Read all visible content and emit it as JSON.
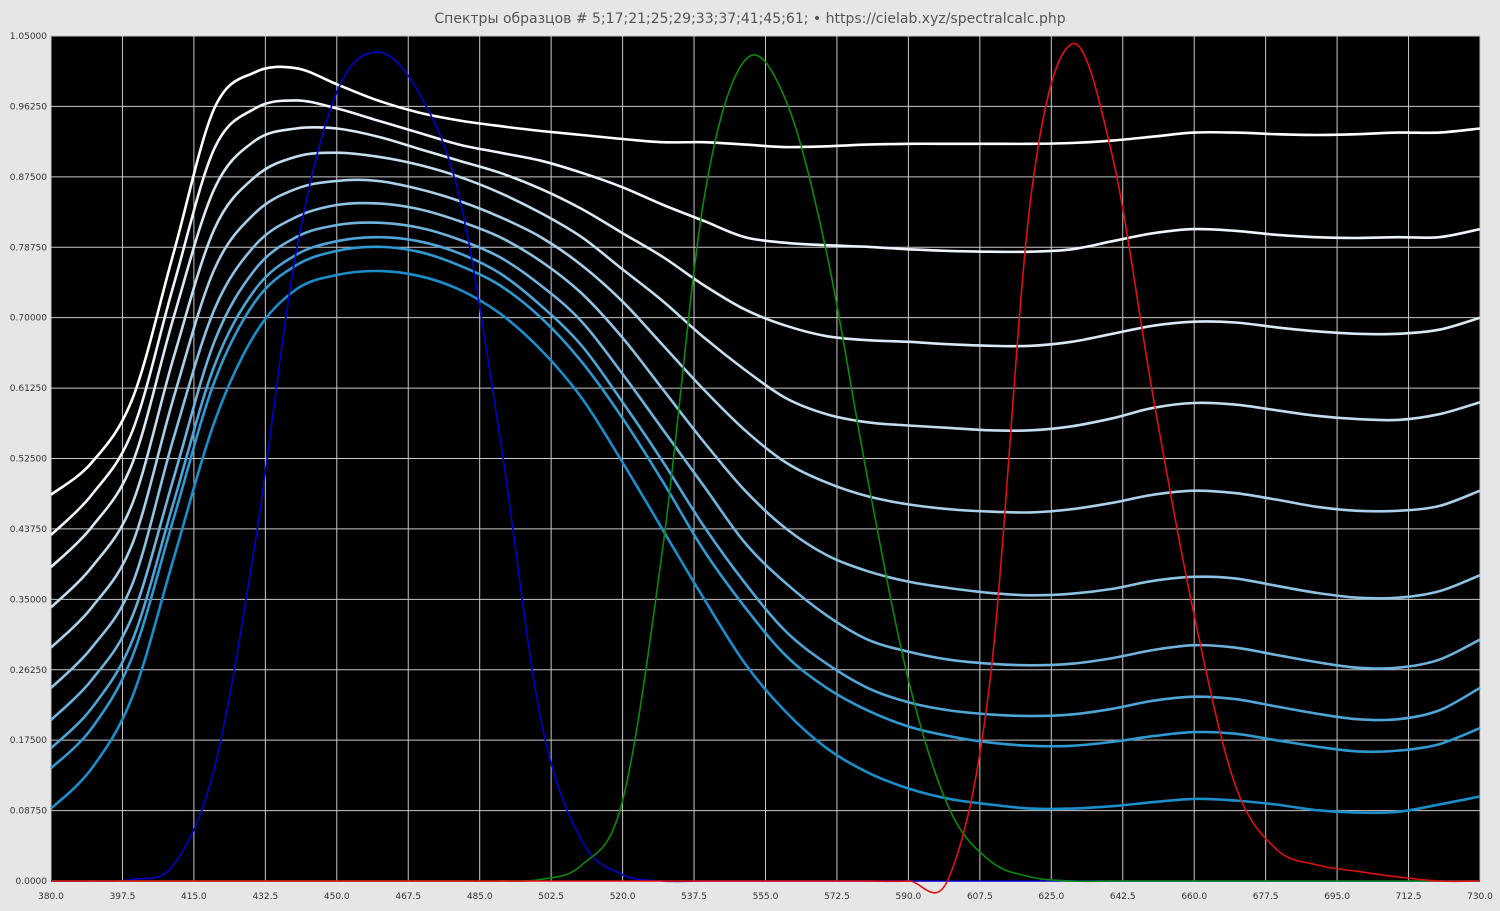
{
  "title": "Спектры образцов # 5;17;21;25;29;33;37;41;45;61;  •  https://cielab.xyz/spectralcalc.php",
  "chart_data": {
    "type": "line",
    "title": "Спектры образцов # 5;17;21;25;29;33;37;41;45;61;  •  https://cielab.xyz/spectralcalc.php",
    "xlim": [
      380,
      730
    ],
    "ylim": [
      0,
      1.05
    ],
    "xticks": [
      "380.0",
      "397.5",
      "415.0",
      "432.5",
      "450.0",
      "467.5",
      "485.0",
      "502.5",
      "520.0",
      "537.5",
      "555.0",
      "572.5",
      "590.0",
      "607.5",
      "625.0",
      "642.5",
      "660.0",
      "677.5",
      "695.0",
      "712.5",
      "730.0"
    ],
    "yticks": [
      "0.0000",
      "0.08750",
      "0.17500",
      "0.26250",
      "0.35000",
      "0.43750",
      "0.52500",
      "0.61250",
      "0.70000",
      "0.78750",
      "0.87500",
      "0.96250",
      "1.05000"
    ],
    "grid": true,
    "background": "#000000",
    "x": [
      380,
      390,
      400,
      410,
      420,
      430,
      440,
      450,
      460,
      470,
      480,
      490,
      500,
      510,
      520,
      530,
      540,
      550,
      560,
      570,
      580,
      590,
      600,
      610,
      620,
      630,
      640,
      650,
      660,
      670,
      680,
      690,
      700,
      710,
      720,
      730
    ],
    "series": [
      {
        "color": "#ffffff",
        "values": [
          0.48,
          0.52,
          0.6,
          0.78,
          0.96,
          1.005,
          1.01,
          0.99,
          0.97,
          0.955,
          0.945,
          0.938,
          0.932,
          0.927,
          0.922,
          0.918,
          0.918,
          0.915,
          0.912,
          0.913,
          0.915,
          0.916,
          0.916,
          0.916,
          0.916,
          0.917,
          0.92,
          0.925,
          0.93,
          0.93,
          0.928,
          0.927,
          0.928,
          0.93,
          0.93,
          0.935
        ]
      },
      {
        "color": "#eef5fa",
        "values": [
          0.43,
          0.48,
          0.56,
          0.74,
          0.91,
          0.96,
          0.97,
          0.96,
          0.945,
          0.93,
          0.915,
          0.905,
          0.895,
          0.88,
          0.862,
          0.84,
          0.82,
          0.8,
          0.793,
          0.79,
          0.788,
          0.785,
          0.783,
          0.782,
          0.782,
          0.785,
          0.795,
          0.805,
          0.81,
          0.808,
          0.803,
          0.8,
          0.799,
          0.8,
          0.8,
          0.81
        ]
      },
      {
        "color": "#d9eaf5",
        "values": [
          0.39,
          0.44,
          0.52,
          0.7,
          0.86,
          0.92,
          0.935,
          0.935,
          0.925,
          0.91,
          0.895,
          0.88,
          0.86,
          0.835,
          0.805,
          0.775,
          0.74,
          0.71,
          0.69,
          0.677,
          0.672,
          0.67,
          0.667,
          0.665,
          0.665,
          0.67,
          0.68,
          0.69,
          0.695,
          0.694,
          0.688,
          0.683,
          0.68,
          0.68,
          0.685,
          0.7
        ]
      },
      {
        "color": "#c2ddef",
        "values": [
          0.34,
          0.39,
          0.47,
          0.65,
          0.81,
          0.875,
          0.9,
          0.905,
          0.9,
          0.89,
          0.875,
          0.855,
          0.83,
          0.8,
          0.76,
          0.72,
          0.675,
          0.635,
          0.6,
          0.58,
          0.57,
          0.566,
          0.563,
          0.56,
          0.56,
          0.565,
          0.575,
          0.588,
          0.594,
          0.592,
          0.585,
          0.578,
          0.574,
          0.573,
          0.58,
          0.595
        ]
      },
      {
        "color": "#a8d0ea",
        "values": [
          0.29,
          0.34,
          0.42,
          0.6,
          0.76,
          0.83,
          0.86,
          0.87,
          0.87,
          0.86,
          0.845,
          0.825,
          0.8,
          0.765,
          0.72,
          0.665,
          0.61,
          0.56,
          0.52,
          0.495,
          0.478,
          0.468,
          0.462,
          0.459,
          0.458,
          0.462,
          0.47,
          0.48,
          0.485,
          0.482,
          0.474,
          0.465,
          0.46,
          0.46,
          0.466,
          0.485
        ]
      },
      {
        "color": "#8cc2e4",
        "values": [
          0.24,
          0.29,
          0.37,
          0.55,
          0.71,
          0.79,
          0.825,
          0.84,
          0.842,
          0.835,
          0.82,
          0.8,
          0.77,
          0.73,
          0.675,
          0.61,
          0.545,
          0.485,
          0.438,
          0.405,
          0.385,
          0.372,
          0.364,
          0.358,
          0.355,
          0.357,
          0.363,
          0.373,
          0.378,
          0.376,
          0.367,
          0.358,
          0.352,
          0.352,
          0.36,
          0.38
        ]
      },
      {
        "color": "#6eb3de",
        "values": [
          0.2,
          0.25,
          0.33,
          0.5,
          0.67,
          0.76,
          0.8,
          0.815,
          0.818,
          0.812,
          0.797,
          0.775,
          0.74,
          0.695,
          0.63,
          0.56,
          0.49,
          0.42,
          0.37,
          0.33,
          0.3,
          0.285,
          0.275,
          0.27,
          0.268,
          0.27,
          0.277,
          0.287,
          0.293,
          0.29,
          0.281,
          0.272,
          0.265,
          0.265,
          0.275,
          0.3
        ]
      },
      {
        "color": "#4ea5d8",
        "values": [
          0.165,
          0.215,
          0.3,
          0.47,
          0.64,
          0.735,
          0.778,
          0.795,
          0.8,
          0.795,
          0.78,
          0.755,
          0.715,
          0.665,
          0.595,
          0.52,
          0.44,
          0.37,
          0.31,
          0.27,
          0.24,
          0.222,
          0.212,
          0.207,
          0.205,
          0.207,
          0.214,
          0.224,
          0.229,
          0.226,
          0.217,
          0.208,
          0.201,
          0.201,
          0.212,
          0.24
        ]
      },
      {
        "color": "#2f99d2",
        "values": [
          0.14,
          0.19,
          0.28,
          0.45,
          0.62,
          0.72,
          0.765,
          0.783,
          0.788,
          0.782,
          0.765,
          0.74,
          0.7,
          0.645,
          0.575,
          0.495,
          0.41,
          0.34,
          0.28,
          0.24,
          0.212,
          0.192,
          0.18,
          0.172,
          0.168,
          0.168,
          0.173,
          0.18,
          0.185,
          0.183,
          0.175,
          0.167,
          0.161,
          0.162,
          0.17,
          0.19
        ]
      },
      {
        "color": "#1a8ecb",
        "values": [
          0.09,
          0.14,
          0.23,
          0.4,
          0.57,
          0.68,
          0.735,
          0.753,
          0.758,
          0.752,
          0.735,
          0.705,
          0.66,
          0.6,
          0.52,
          0.435,
          0.35,
          0.27,
          0.21,
          0.165,
          0.135,
          0.115,
          0.102,
          0.095,
          0.09,
          0.09,
          0.093,
          0.098,
          0.102,
          0.1,
          0.095,
          0.088,
          0.085,
          0.086,
          0.095,
          0.105
        ]
      },
      {
        "color": "#0000cc",
        "values": [
          0.0,
          0.0,
          0.002,
          0.02,
          0.14,
          0.42,
          0.78,
          0.98,
          1.03,
          0.98,
          0.85,
          0.55,
          0.2,
          0.05,
          0.008,
          0.0,
          0.0,
          0.0,
          0.0,
          0.0,
          0.0,
          0.0,
          0.0,
          0.0,
          0.0,
          0.0,
          0.0,
          0.0,
          0.0,
          0.0,
          0.0,
          0.0,
          0.0,
          0.0,
          0.0,
          0.0
        ]
      },
      {
        "color": "#0a8a0a",
        "values": [
          0.0,
          0.0,
          0.0,
          0.0,
          0.0,
          0.0,
          0.0,
          0.0,
          0.0,
          0.0,
          0.0,
          0.0,
          0.002,
          0.02,
          0.1,
          0.42,
          0.85,
          1.02,
          0.97,
          0.78,
          0.5,
          0.25,
          0.09,
          0.025,
          0.005,
          0.0,
          0.0,
          0.0,
          0.0,
          0.0,
          0.0,
          0.0,
          0.0,
          0.0,
          0.0,
          0.0
        ]
      },
      {
        "color": "#e01010",
        "values": [
          0.0,
          0.0,
          0.0,
          0.0,
          0.0,
          0.0,
          0.0,
          0.0,
          0.0,
          0.0,
          0.0,
          0.0,
          0.0,
          0.0,
          0.0,
          0.0,
          0.0,
          0.0,
          0.0,
          0.0,
          0.0,
          0.0,
          0.005,
          0.25,
          0.85,
          1.04,
          0.9,
          0.6,
          0.33,
          0.12,
          0.04,
          0.02,
          0.012,
          0.005,
          0.0,
          0.0
        ]
      }
    ]
  }
}
